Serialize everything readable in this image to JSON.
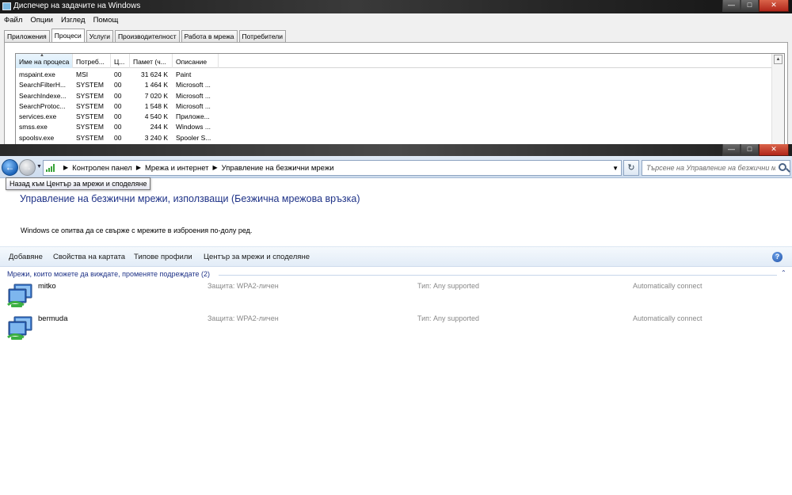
{
  "task_manager": {
    "title": "Диспечер на задачите на Windows",
    "menu": [
      "Файл",
      "Опции",
      "Изглед",
      "Помощ"
    ],
    "tabs": [
      "Приложения",
      "Процеси",
      "Услуги",
      "Производителност",
      "Работа в мрежа",
      "Потребители"
    ],
    "active_tab": 1,
    "columns": [
      "Име на процеса",
      "Потреб...",
      "Ц...",
      "Памет (ч...",
      "Описание"
    ],
    "rows": [
      [
        "mspaint.exe",
        "MSI",
        "00",
        "31 624 K",
        "Paint"
      ],
      [
        "SearchFilterH...",
        "SYSTEM",
        "00",
        "1 464 K",
        "Microsoft ..."
      ],
      [
        "SearchIndexe...",
        "SYSTEM",
        "00",
        "7 020 K",
        "Microsoft ..."
      ],
      [
        "SearchProtoc...",
        "SYSTEM",
        "00",
        "1 548 K",
        "Microsoft ..."
      ],
      [
        "services.exe",
        "SYSTEM",
        "00",
        "4 540 K",
        "Приложе..."
      ],
      [
        "smss.exe",
        "SYSTEM",
        "00",
        "244 K",
        "Windows ..."
      ],
      [
        "spoolsv.exe",
        "SYSTEM",
        "00",
        "3 240 K",
        "Spooler S..."
      ]
    ]
  },
  "explorer": {
    "breadcrumb": [
      "Контролен панел",
      "Мрежа и интернет",
      "Управление на безжични мрежи"
    ],
    "search_placeholder": "Търсене на Управление на безжични мрежи",
    "tooltip": "Назад към Център за мрежи и споделяне",
    "heading": "Управление на безжични мрежи, използващи (Безжична мрежова връзка)",
    "description": "Windows се опитва да се свърже с мрежите в изброения по-долу ред.",
    "commands": [
      "Добавяне",
      "Свойства на картата",
      "Типове профили",
      "Център за мрежи и споделяне"
    ],
    "group_header": "Мрежи, които можете да виждате, променяте подреждате (2)",
    "networks": [
      {
        "name": "mitko",
        "security": "Защита: WPA2-личен",
        "type": "Тип: Any supported",
        "mode": "Automatically connect"
      },
      {
        "name": "bermuda",
        "security": "Защита: WPA2-личен",
        "type": "Тип: Any supported",
        "mode": "Automatically connect"
      }
    ]
  },
  "icons": {
    "minimize": "minimize-icon",
    "maximize": "maximize-icon",
    "close": "close-icon",
    "back": "back-arrow-icon",
    "forward": "forward-arrow-icon",
    "search": "search-icon",
    "help": "help-icon",
    "network": "wireless-network-icon"
  },
  "colors": {
    "link_blue": "#1e3287",
    "titlebar_dark": "#262626"
  }
}
